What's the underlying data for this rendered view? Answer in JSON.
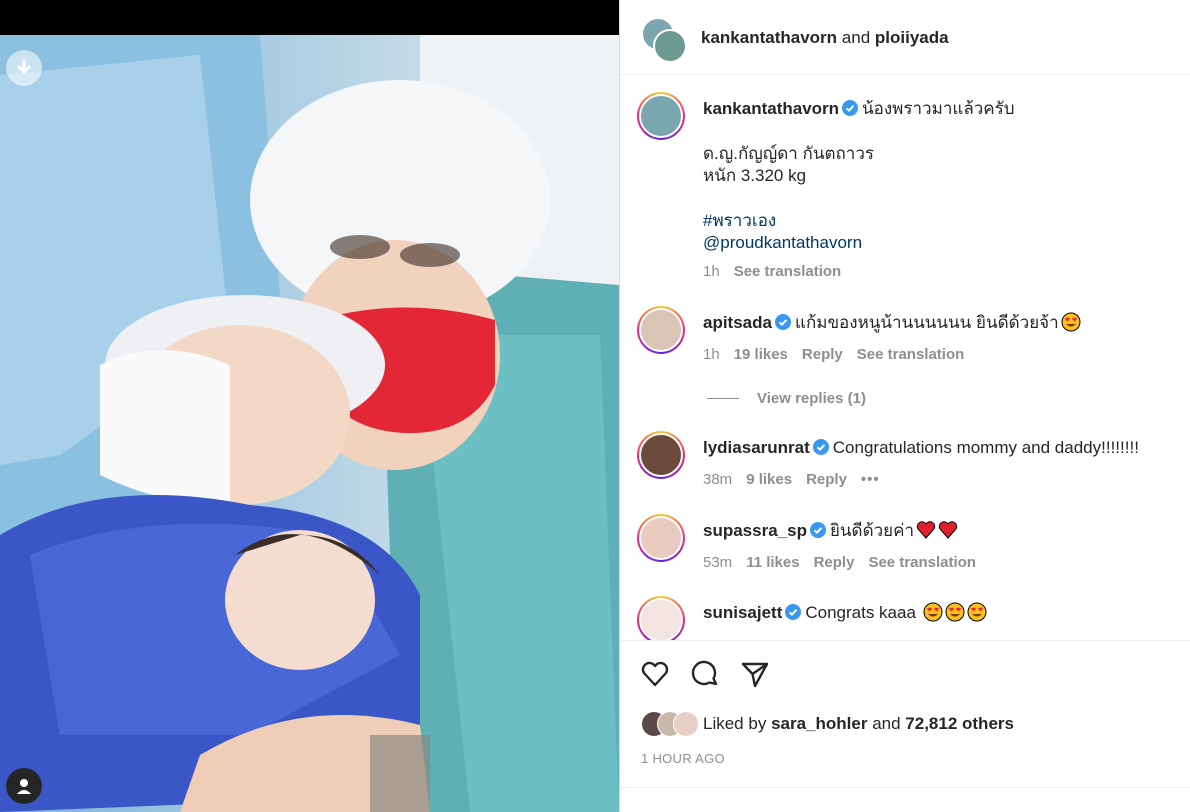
{
  "header": {
    "owner": "kankantathavorn",
    "joiner": "and",
    "collaborator": "ploiiyada"
  },
  "post": {
    "author": "kankantathavorn",
    "caption_line1": "น้องพราวมาแล้วครับ",
    "caption_line2": "ด.ญ.กัญญ์ดา กันตถาวร",
    "caption_line3": "หนัก 3.320 kg",
    "hashtag": "#พราวเอง",
    "mention": "@proudkantathavorn",
    "time": "1h",
    "see_translation": "See translation"
  },
  "comments": [
    {
      "user": "apitsada",
      "text": "แก้มของหนูน้านนนนนน ยินดีด้วยจ้า",
      "emoji": "heart-eyes",
      "time": "1h",
      "likes": "19 likes",
      "reply": "Reply",
      "translate": "See translation",
      "view_replies": "View replies (1)"
    },
    {
      "user": "lydiasarunrat",
      "text": "Congratulations mommy and daddy!!!!!!!!",
      "time": "38m",
      "likes": "9 likes",
      "reply": "Reply",
      "more": "•••"
    },
    {
      "user": "supassra_sp",
      "text": "ยินดีด้วยค่า",
      "emoji": "red-hearts",
      "time": "53m",
      "likes": "11 likes",
      "reply": "Reply",
      "translate": "See translation"
    },
    {
      "user": "sunisajett",
      "text": "Congrats kaaa",
      "emoji": "heart-eyes-x3"
    }
  ],
  "actions": {
    "liked_prefix": "Liked by",
    "liked_user": "sara_hohler",
    "liked_and": "and",
    "liked_others": "72,812 others",
    "timestamp": "1 HOUR AGO"
  },
  "icons": [
    "download-icon",
    "user-icon",
    "verified-badge-icon",
    "heart-icon",
    "comment-icon",
    "share-icon"
  ],
  "colors": {
    "verified": "#3897f0",
    "link": "#00376b",
    "muted": "#8e8e8e",
    "heart": "#ed4956"
  }
}
